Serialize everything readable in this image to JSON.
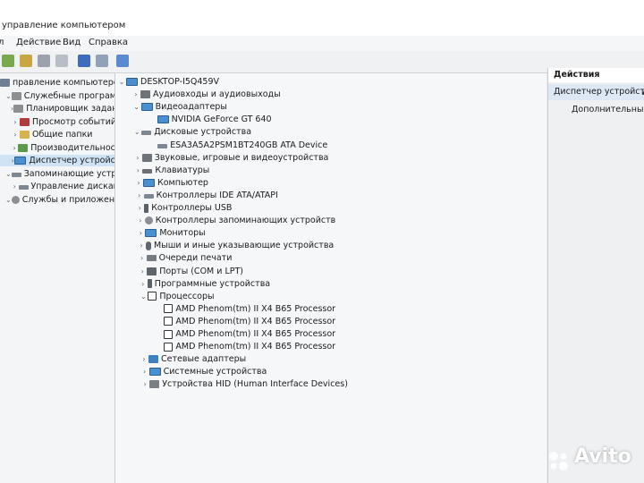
{
  "window": {
    "title": "управление компьютером"
  },
  "menu": [
    "Действие",
    "Вид",
    "Справка"
  ],
  "left_tree": [
    {
      "label": "правление компьютером (л",
      "indent": 0
    },
    {
      "label": "Служебные программы",
      "indent": 1
    },
    {
      "label": "Планировщик заданий",
      "indent": 2
    },
    {
      "label": "Просмотр событий",
      "indent": 2
    },
    {
      "label": "Общие папки",
      "indent": 2
    },
    {
      "label": "Производительность",
      "indent": 2
    },
    {
      "label": "Диспетчер устройств",
      "indent": 2,
      "selected": true
    },
    {
      "label": "Запоминающие устройст",
      "indent": 1
    },
    {
      "label": "Управление дисками",
      "indent": 2
    },
    {
      "label": "Службы и приложения",
      "indent": 1
    }
  ],
  "device_tree": {
    "root": "DESKTOP-I5Q459V",
    "items": [
      {
        "label": "Аудиовходы и аудиовыходы",
        "expanded": false,
        "icon": "speaker-icon"
      },
      {
        "label": "Видеоадаптеры",
        "expanded": true,
        "icon": "monitor-icon",
        "children": [
          "NVIDIA GeForce GT 640"
        ]
      },
      {
        "label": "Дисковые устройства",
        "expanded": true,
        "icon": "disk-icon",
        "children": [
          "ESA3A5A2PSM1BT240GB ATA Device"
        ]
      },
      {
        "label": "Звуковые, игровые и видеоустройства",
        "expanded": false,
        "icon": "speaker-icon"
      },
      {
        "label": "Клавиатуры",
        "expanded": false,
        "icon": "keyboard-icon"
      },
      {
        "label": "Компьютер",
        "expanded": false,
        "icon": "monitor-icon"
      },
      {
        "label": "Контроллеры IDE ATA/ATAPI",
        "expanded": false,
        "icon": "disk-icon"
      },
      {
        "label": "Контроллеры USB",
        "expanded": false,
        "icon": "usb-icon"
      },
      {
        "label": "Контроллеры запоминающих устройств",
        "expanded": false,
        "icon": "gear-icon"
      },
      {
        "label": "Мониторы",
        "expanded": false,
        "icon": "monitor-icon"
      },
      {
        "label": "Мыши и иные указывающие устройства",
        "expanded": false,
        "icon": "mouse-icon"
      },
      {
        "label": "Очереди печати",
        "expanded": false,
        "icon": "printer-icon"
      },
      {
        "label": "Порты (COM и LPT)",
        "expanded": false,
        "icon": "port-icon"
      },
      {
        "label": "Программные устройства",
        "expanded": false,
        "icon": "usb-icon"
      },
      {
        "label": "Процессоры",
        "expanded": true,
        "icon": "cpu-icon",
        "children": [
          "AMD Phenom(tm) II X4 B65 Processor",
          "AMD Phenom(tm) II X4 B65 Processor",
          "AMD Phenom(tm) II X4 B65 Processor",
          "AMD Phenom(tm) II X4 B65 Processor"
        ]
      },
      {
        "label": "Сетевые адаптеры",
        "expanded": false,
        "icon": "network-icon"
      },
      {
        "label": "Системные устройства",
        "expanded": false,
        "icon": "monitor-icon"
      },
      {
        "label": "Устройства HID (Human Interface Devices)",
        "expanded": false,
        "icon": "hid-icon"
      }
    ]
  },
  "actions": {
    "header": "Действия",
    "item": "Диспетчер устройств",
    "more": "Дополнительные"
  },
  "watermark": "Avito"
}
